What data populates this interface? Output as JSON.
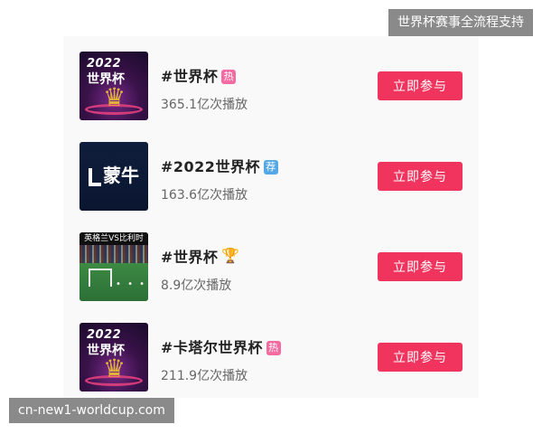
{
  "corner_label": "世界杯赛事全流程支持",
  "watermark": "cn-new1-worldcup.com",
  "topics": [
    {
      "title": "#世界杯",
      "badge": "热",
      "views": "365.1亿次播放",
      "button": "立即参与",
      "thumb": {
        "year": "2022",
        "caption": "世界杯"
      }
    },
    {
      "title": "#2022世界杯",
      "badge": "荐",
      "views": "163.6亿次播放",
      "button": "立即参与",
      "thumb": {
        "brand": "蒙牛"
      }
    },
    {
      "title": "#世界杯",
      "badge": "🏆",
      "views": "8.9亿次播放",
      "button": "立即参与",
      "thumb": {
        "banner": "英格兰VS比利时"
      }
    },
    {
      "title": "#卡塔尔世界杯",
      "badge": "热",
      "views": "211.9亿次播放",
      "button": "立即参与",
      "thumb": {
        "year": "2022",
        "caption": "世界杯"
      }
    }
  ],
  "colors": {
    "button": "#f0345e",
    "hot_badge": "#f56aa0",
    "rec_badge": "#55a8e6"
  }
}
